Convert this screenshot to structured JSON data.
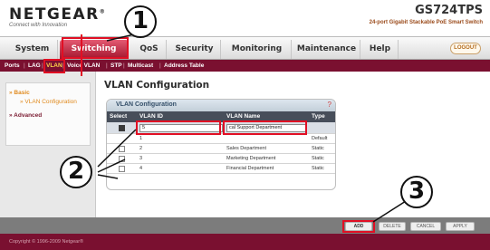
{
  "header": {
    "logo": "NETGEAR",
    "tagline": "Connect with Innovation",
    "model": "GS724TPS",
    "model_desc": "24-port Gigabit Stackable PoE Smart Switch",
    "logout_label": "LOGOUT"
  },
  "topnav": {
    "tabs": [
      {
        "label": "System"
      },
      {
        "label": "Switching",
        "active": true
      },
      {
        "label": "QoS"
      },
      {
        "label": "Security"
      },
      {
        "label": "Monitoring"
      },
      {
        "label": "Maintenance"
      },
      {
        "label": "Help"
      }
    ]
  },
  "subnav": {
    "items": [
      {
        "label": "Ports"
      },
      {
        "label": "LAG"
      },
      {
        "label": "VLAN",
        "active": true
      },
      {
        "label": "Voice VLAN"
      },
      {
        "label": "STP"
      },
      {
        "label": "Multicast"
      },
      {
        "label": "Address Table"
      }
    ]
  },
  "sidebar": {
    "basic_label": "» Basic",
    "vlan_config_label": "» VLAN Configuration",
    "advanced_label": "» Advanced"
  },
  "content": {
    "title": "VLAN Configuration",
    "panel_title": "VLAN Configuration",
    "help_icon": "?",
    "columns": [
      "Select",
      "VLAN ID",
      "VLAN Name",
      "Type"
    ],
    "input_row": {
      "vlan_id": "5",
      "vlan_name": "cal Support Department"
    },
    "rows": [
      {
        "vlan_id": "1",
        "vlan_name": "",
        "type": "Default"
      },
      {
        "vlan_id": "2",
        "vlan_name": "Sales Department",
        "type": "Static"
      },
      {
        "vlan_id": "3",
        "vlan_name": "Marketing Department",
        "type": "Static"
      },
      {
        "vlan_id": "4",
        "vlan_name": "Financial Department",
        "type": "Static"
      }
    ]
  },
  "buttons": {
    "add": "ADD",
    "delete": "DELETE",
    "cancel": "CANCEL",
    "apply": "APPLY"
  },
  "footer": {
    "copyright": "Copyright © 1996-2009 Netgear®"
  },
  "annotations": {
    "step1": "1",
    "step2": "2",
    "step3": "3",
    "highlight_color": "#e10f24"
  }
}
